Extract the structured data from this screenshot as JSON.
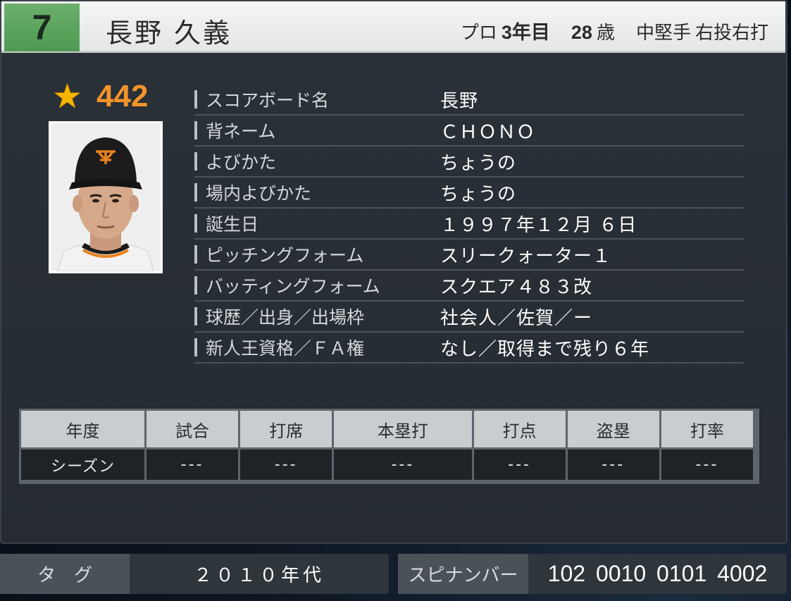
{
  "header": {
    "number": "7",
    "name": "長野 久義",
    "pro_label": "プロ",
    "years": "3年目",
    "age": "28",
    "age_unit": "歳",
    "position": "中堅手",
    "handedness": "右投右打",
    "number_color": "#5aa55c"
  },
  "rating": {
    "icon": "star-icon",
    "value": "442",
    "color": "#f3942a"
  },
  "portrait": {
    "alt": "player-portrait"
  },
  "profile": [
    {
      "label": "スコアボード名",
      "value": "長野"
    },
    {
      "label": "背ネーム",
      "value": "ＣＨＯＮＯ"
    },
    {
      "label": "よびかた",
      "value": "ちょうの"
    },
    {
      "label": "場内よびかた",
      "value": "ちょうの"
    },
    {
      "label": "誕生日",
      "value": "１９９７年１２月 ６日"
    },
    {
      "label": "ピッチングフォーム",
      "value": "スリークォーター１"
    },
    {
      "label": "バッティングフォーム",
      "value": "スクエア４８３改"
    },
    {
      "label": "球歴／出身／出場枠",
      "value": "社会人／佐賀／ー"
    },
    {
      "label": "新人王資格／ＦＡ権",
      "value": "なし／取得まで残り６年"
    }
  ],
  "stats": {
    "headers": [
      "年度",
      "試合",
      "打席",
      "本塁打",
      "打点",
      "盗塁",
      "打率"
    ],
    "row": [
      "シーズン",
      "---",
      "---",
      "---",
      "---",
      "---",
      "---"
    ]
  },
  "footer": {
    "tag_label": "タグ",
    "tag_value": "２０１０年代",
    "spin_label": "スピナンバー",
    "spin_value": "102 0010 0101 4002"
  }
}
